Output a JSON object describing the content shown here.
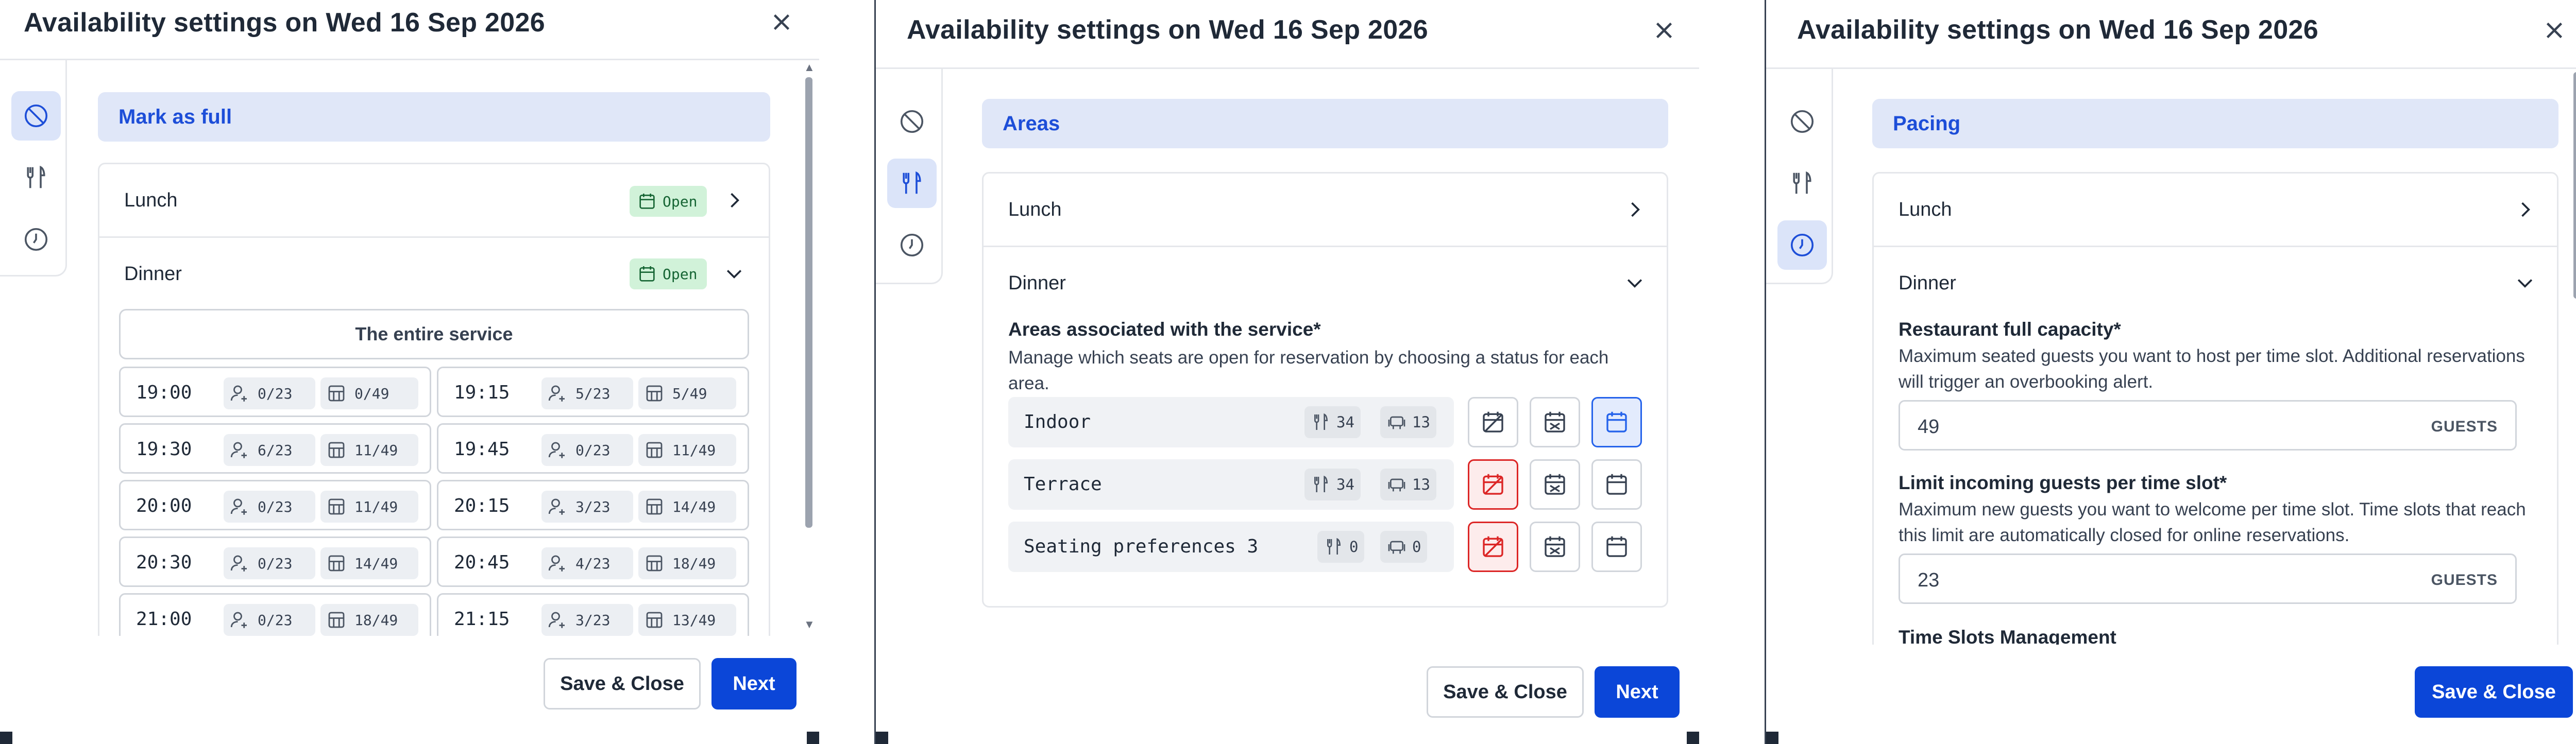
{
  "colors": {
    "primary": "#0b46d8",
    "accent": "#1d4ed8",
    "open_badge": "#d1f2d9",
    "full_red": "#dc2626"
  },
  "dialogs": [
    {
      "title": "Availability settings on Wed 16 Sep 2026",
      "section_title": "Mark as full",
      "rail_active": "mark-as-full",
      "services": [
        {
          "name": "Lunch",
          "status": "Open",
          "expanded": false
        },
        {
          "name": "Dinner",
          "status": "Open",
          "expanded": true
        }
      ],
      "entire_service_label": "The entire service",
      "slots": [
        {
          "time": "19:00",
          "guests": "0/23",
          "tables": "0/49"
        },
        {
          "time": "19:15",
          "guests": "5/23",
          "tables": "5/49"
        },
        {
          "time": "19:30",
          "guests": "6/23",
          "tables": "11/49"
        },
        {
          "time": "19:45",
          "guests": "0/23",
          "tables": "11/49"
        },
        {
          "time": "20:00",
          "guests": "0/23",
          "tables": "11/49"
        },
        {
          "time": "20:15",
          "guests": "3/23",
          "tables": "14/49"
        },
        {
          "time": "20:30",
          "guests": "0/23",
          "tables": "14/49"
        },
        {
          "time": "20:45",
          "guests": "4/23",
          "tables": "18/49"
        },
        {
          "time": "21:00",
          "guests": "0/23",
          "tables": "18/49"
        },
        {
          "time": "21:15",
          "guests": "3/23",
          "tables": "13/49"
        }
      ],
      "buttons": {
        "save_close": "Save & Close",
        "next": "Next"
      }
    },
    {
      "title": "Availability settings on Wed 16 Sep 2026",
      "section_title": "Areas",
      "rail_active": "areas",
      "services": [
        {
          "name": "Lunch",
          "expanded": false
        },
        {
          "name": "Dinner",
          "expanded": true
        }
      ],
      "areas_label": "Areas associated with the service*",
      "areas_help": "Manage which seats are open for reservation by choosing a status for each area.",
      "areas": [
        {
          "name": "Indoor",
          "seats": "34",
          "tables": "13",
          "status": "open"
        },
        {
          "name": "Terrace",
          "seats": "34",
          "tables": "13",
          "status": "full"
        },
        {
          "name": "Seating preferences 3",
          "seats": "0",
          "tables": "0",
          "status": "full"
        }
      ],
      "buttons": {
        "save_close": "Save & Close",
        "next": "Next"
      }
    },
    {
      "title": "Availability settings on Wed 16 Sep 2026",
      "section_title": "Pacing",
      "rail_active": "pacing",
      "services": [
        {
          "name": "Lunch",
          "expanded": false
        },
        {
          "name": "Dinner",
          "expanded": true
        }
      ],
      "capacity_label": "Restaurant full capacity*",
      "capacity_help": "Maximum seated guests you want to host per time slot. Additional reservations will trigger an overbooking alert.",
      "capacity_value": "49",
      "capacity_unit": "GUESTS",
      "limit_label": "Limit incoming guests per time slot*",
      "limit_help": "Maximum new guests you want to welcome per time slot. Time slots that reach this limit are automatically closed for online reservations.",
      "limit_value": "23",
      "limit_unit": "GUESTS",
      "time_slots_label": "Time Slots Management",
      "buttons": {
        "save_close": "Save & Close"
      }
    }
  ]
}
